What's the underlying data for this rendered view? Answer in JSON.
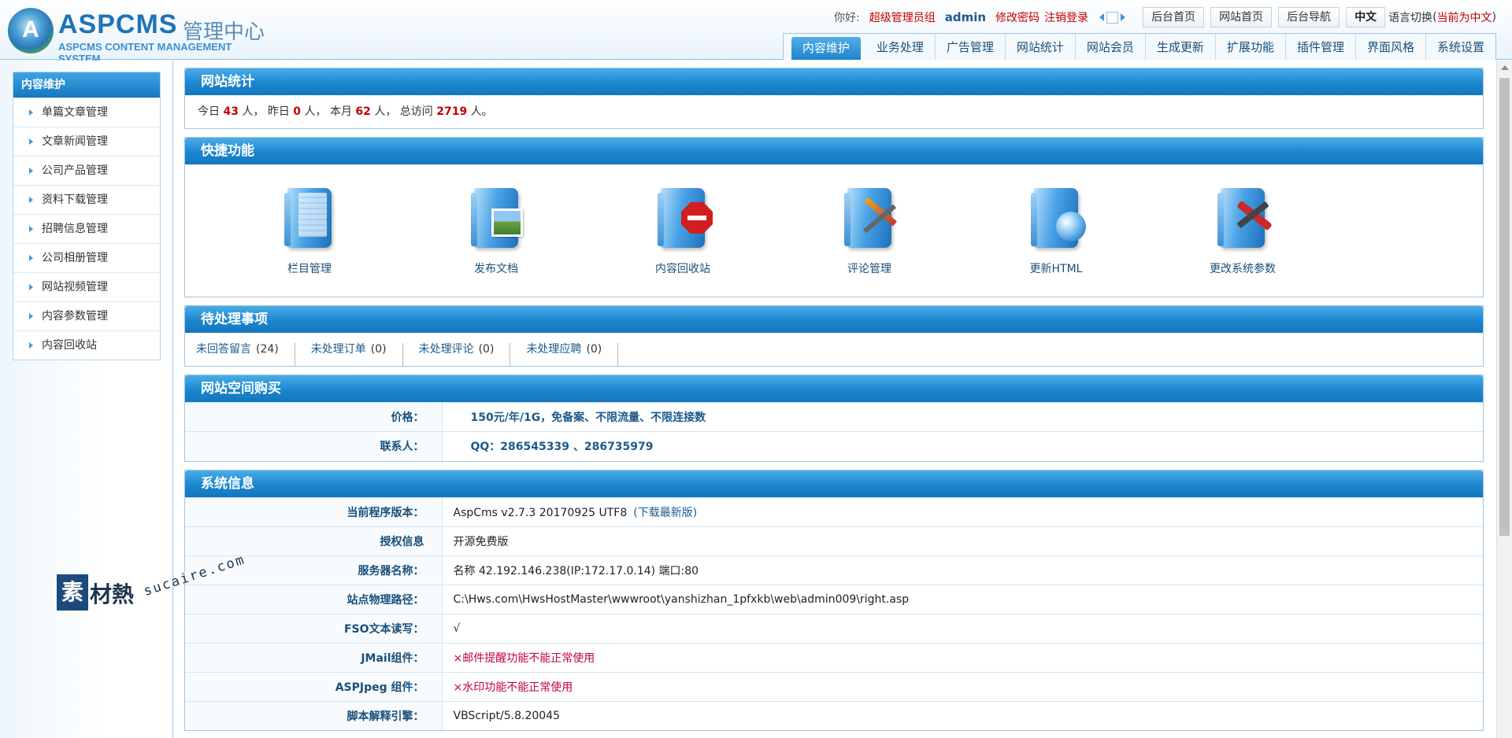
{
  "header": {
    "brand": "ASPCMS",
    "brand_cn": "管理中心",
    "brand_en": "ASPCMS CONTENT MANAGEMENT SYSTEM",
    "greeting": "你好:",
    "group": "超级管理员组",
    "username": "admin",
    "change_pwd": "修改密码",
    "logout": "注销登录",
    "btn_admin_home": "后台首页",
    "btn_site_home": "网站首页",
    "btn_admin_nav": "后台导航",
    "btn_lang": "中文",
    "lang_switch": "语言切换",
    "lang_current_open": "(",
    "lang_current": "当前为中文",
    "lang_current_close": ")"
  },
  "nav": {
    "tabs": [
      "内容维护",
      "业务处理",
      "广告管理",
      "网站统计",
      "网站会员",
      "生成更新",
      "扩展功能",
      "插件管理",
      "界面风格",
      "系统设置"
    ]
  },
  "sidebar": {
    "title": "内容维护",
    "items": [
      "单篇文章管理",
      "文章新闻管理",
      "公司产品管理",
      "资料下载管理",
      "招聘信息管理",
      "公司相册管理",
      "网站视频管理",
      "内容参数管理",
      "内容回收站"
    ]
  },
  "stats": {
    "title": "网站统计",
    "today_lbl": "今日",
    "today": "43",
    "yesterday_lbl": "人， 昨日",
    "yesterday": "0",
    "month_lbl": "人， 本月",
    "month": "62",
    "total_lbl": "人， 总访问",
    "total": "2719",
    "end": "人。"
  },
  "quick": {
    "title": "快捷功能",
    "items": [
      {
        "label": "栏目管理",
        "icon": "book-folder-icon"
      },
      {
        "label": "发布文档",
        "icon": "photo-folder-icon"
      },
      {
        "label": "内容回收站",
        "icon": "stop-folder-icon"
      },
      {
        "label": "评论管理",
        "icon": "pen-folder-icon"
      },
      {
        "label": "更新HTML",
        "icon": "globe-folder-icon"
      },
      {
        "label": "更改系统参数",
        "icon": "tools-folder-icon"
      }
    ]
  },
  "todo": {
    "title": "待处理事项",
    "items": [
      {
        "label": "未回答留言",
        "count": "(24)"
      },
      {
        "label": "未处理订单",
        "count": "(0)"
      },
      {
        "label": "未处理评论",
        "count": "(0)"
      },
      {
        "label": "未处理应聘",
        "count": "(0)"
      }
    ]
  },
  "hosting": {
    "title": "网站空间购买",
    "rows": [
      {
        "k": "价格：",
        "v": "150元/年/1G，免备案、不限流量、不限连接数"
      },
      {
        "k": "联系人：",
        "v": "QQ：286545339 、286735979"
      }
    ]
  },
  "sysinfo": {
    "title": "系统信息",
    "version_k": "当前程序版本：",
    "version_v": "AspCms v2.7.3 20170925 UTF8",
    "download": "(下载最新版)",
    "rows": [
      {
        "k": "授权信息",
        "v": "开源免费版"
      },
      {
        "k": "服务器名称：",
        "v": "名称 42.192.146.238(IP:172.17.0.14) 端口:80"
      },
      {
        "k": "站点物理路径：",
        "v": "C:\\Hws.com\\HwsHostMaster\\wwwroot\\yanshizhan_1pfxkb\\web\\admin009\\right.asp"
      },
      {
        "k": "FSO文本读写：",
        "v": "√"
      }
    ],
    "red_rows": [
      {
        "k": "JMail组件：",
        "v": "×邮件提醒功能不能正常使用"
      },
      {
        "k": "ASPJpeg 组件：",
        "v": "×水印功能不能正常使用"
      }
    ],
    "last": {
      "k": "脚本解释引擎：",
      "v": "VBScript/5.8.20045"
    }
  },
  "watermark": {
    "a": "素",
    "b": "材熱",
    "c": "sucaire.com"
  },
  "colors": {
    "accent": "#1b86cf",
    "alert": "#c40000",
    "link": "#1d5a8e"
  }
}
